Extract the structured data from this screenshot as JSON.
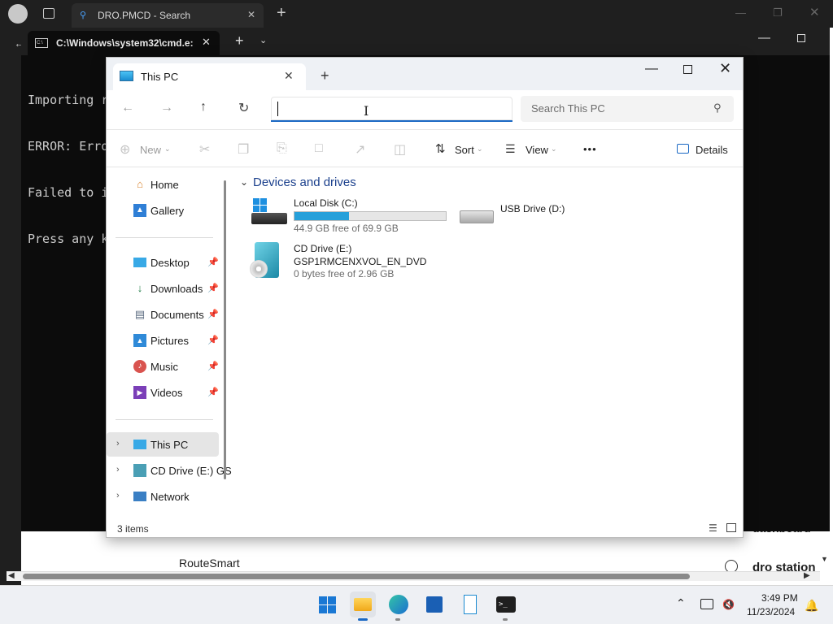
{
  "browser": {
    "tab_title": "DRO.PMCD - Search",
    "tab_close": "✕",
    "new_tab": "+"
  },
  "background_page": {
    "route_smart": "RouteSmart",
    "dro_station": "dro station",
    "dashboard": "dashboard"
  },
  "terminal": {
    "tab_title": "C:\\Windows\\system32\\cmd.e:",
    "tab_close": "✕",
    "new_tab": "+",
    "dropdown": "⌄",
    "lines": [
      "Importing r",
      "ERROR: Erro",
      "Failed to i",
      "Press any k"
    ]
  },
  "explorer": {
    "tab_title": "This PC",
    "tab_close": "✕",
    "new_tab": "+",
    "window_min": "—",
    "window_close": "✕",
    "address_value": "",
    "search_placeholder": "Search This PC",
    "toolbar": {
      "new_label": "New",
      "sort_label": "Sort",
      "view_label": "View",
      "more_label": "•••",
      "details_label": "Details"
    },
    "sidebar": {
      "home": "Home",
      "gallery": "Gallery",
      "desktop": "Desktop",
      "downloads": "Downloads",
      "documents": "Documents",
      "pictures": "Pictures",
      "music": "Music",
      "videos": "Videos",
      "this_pc": "This PC",
      "cd_drive": "CD Drive (E:) GS",
      "network": "Network"
    },
    "group_header": "Devices and drives",
    "drives": {
      "c": {
        "name": "Local Disk (C:)",
        "free": "44.9 GB free of 69.9 GB",
        "used_fraction": 0.358
      },
      "d": {
        "name": "USB Drive (D:)"
      },
      "e": {
        "name": "CD Drive (E:)",
        "label": "GSP1RMCENXVOL_EN_DVD",
        "free": "0 bytes free of 2.96 GB"
      }
    },
    "status": "3 items"
  },
  "taskbar": {
    "time": "3:49 PM",
    "date": "11/23/2024"
  },
  "colors": {
    "accent": "#1a68c4",
    "drive_bar": "#26a0da",
    "group_header": "#1a3f8c"
  }
}
